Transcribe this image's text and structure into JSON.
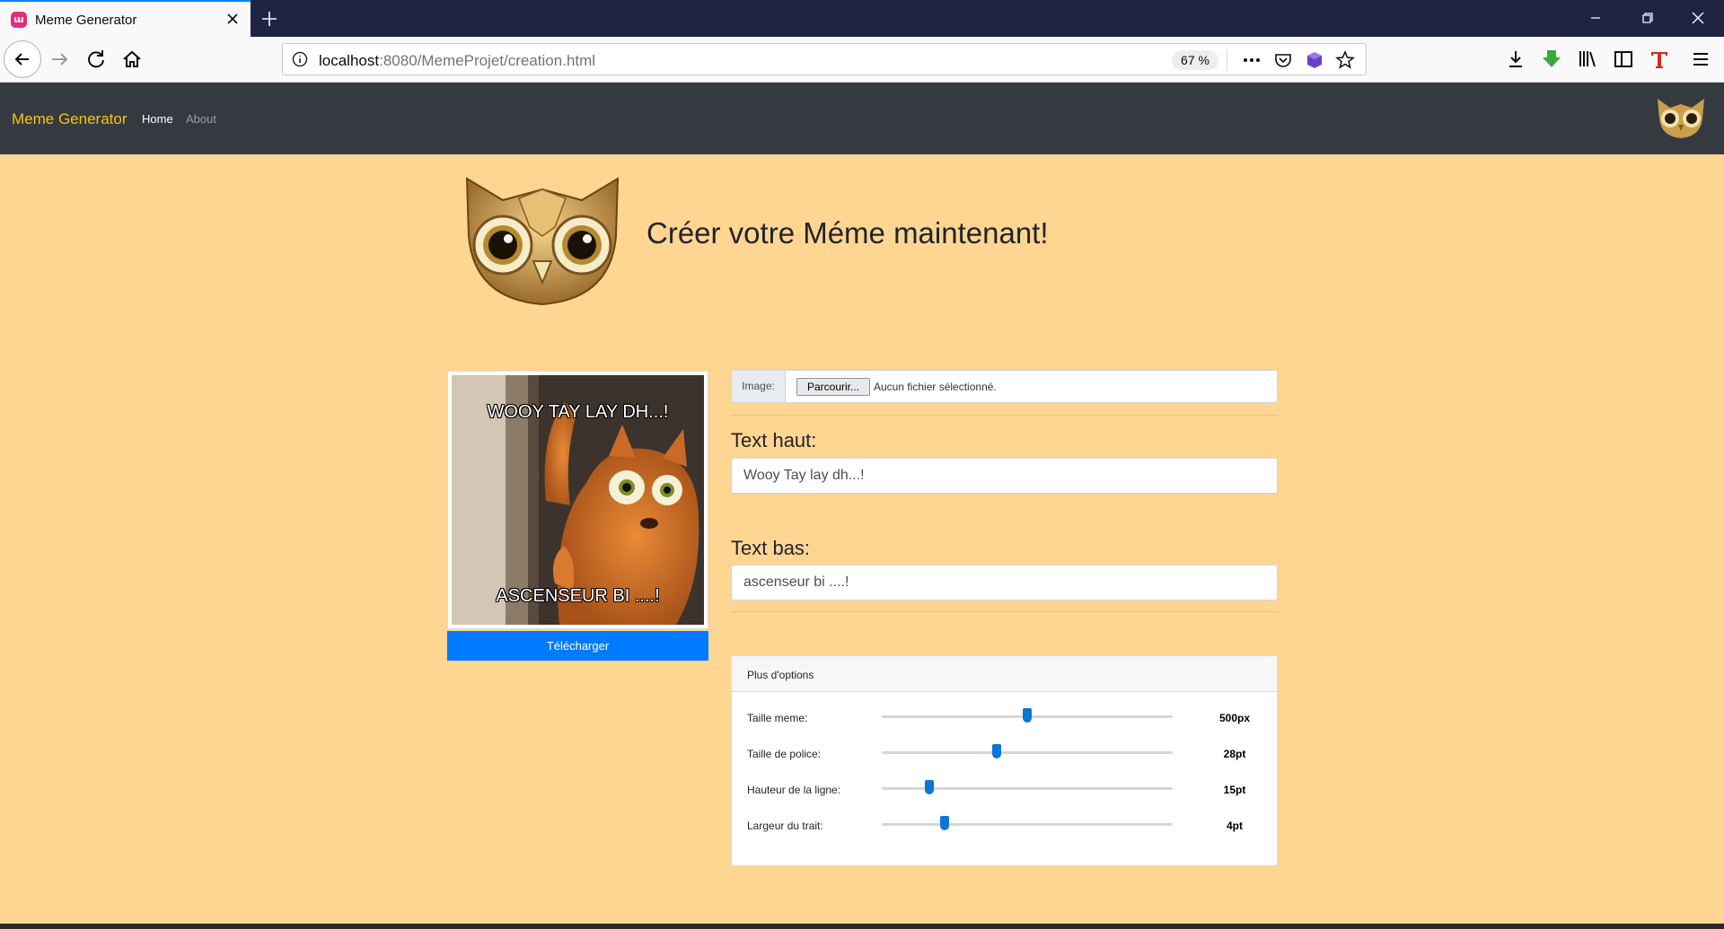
{
  "browser": {
    "tab_title": "Meme Generator",
    "url_host": "localhost",
    "url_rest": ":8080/MemeProjet/creation.html",
    "zoom": "67 %"
  },
  "navbar": {
    "brand": "Meme Generator",
    "links": [
      "Home",
      "About"
    ]
  },
  "hero": {
    "title": "Créer votre Méme maintenant!"
  },
  "meme": {
    "top_text": "WOOY TAY LAY DH...!",
    "bottom_text": "ASCENSEUR BI ....!",
    "download_label": "Télécharger"
  },
  "form": {
    "image_label": "Image:",
    "browse_label": "Parcourir...",
    "file_status": "Aucun fichier sélectionné.",
    "top_label": "Text haut:",
    "top_value": "Wooy Tay lay dh...!",
    "bottom_label": "Text bas:",
    "bottom_value": "ascenseur bi ....!"
  },
  "options": {
    "title": "Plus d'options",
    "items": [
      {
        "label": "Taille meme:",
        "value": "500px",
        "fraction": 0.5
      },
      {
        "label": "Taille de police:",
        "value": "28pt",
        "fraction": 0.395
      },
      {
        "label": "Hauteur de la ligne:",
        "value": "15pt",
        "fraction": 0.165
      },
      {
        "label": "Largeur du trait:",
        "value": "4pt",
        "fraction": 0.215
      }
    ]
  },
  "colors": {
    "page_bg": "#ffd592",
    "navbar_bg": "#343a40",
    "brand": "#ffc107",
    "primary": "#007bff",
    "slider_thumb": "#0b76d6"
  }
}
